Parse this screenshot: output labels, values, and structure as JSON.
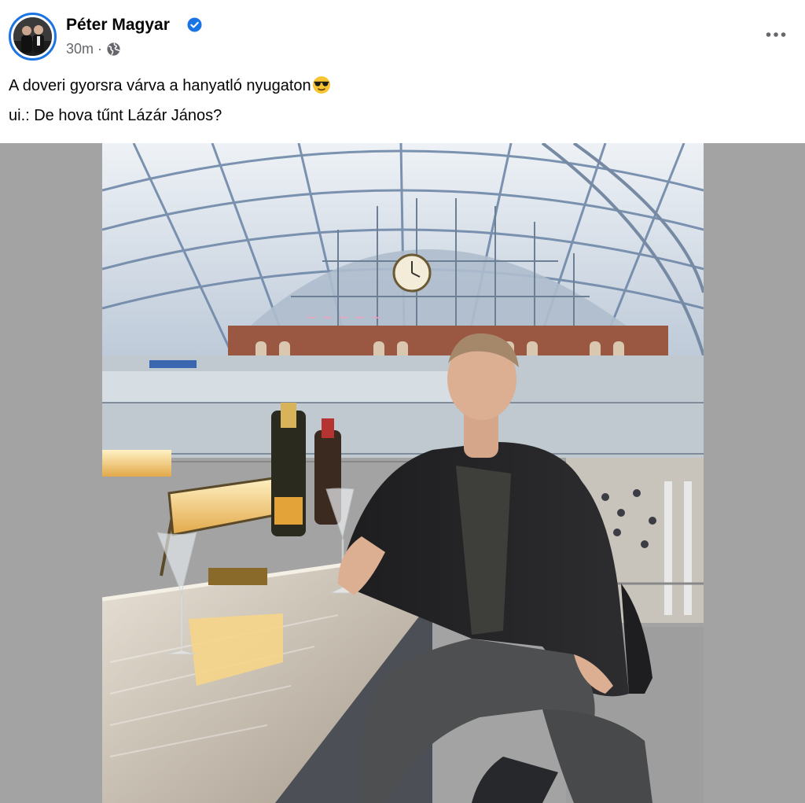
{
  "post": {
    "author_name": "Péter Magyar",
    "verified": true,
    "time": "30m",
    "separator": "·",
    "audience_icon": "globe-icon",
    "text_line1": "A doveri gyorsra várva a hanyatló nyugaton",
    "text_line1_emoji": "smiling-face-with-sunglasses",
    "text_line2": "ui.: De hova tűnt Lázár János?"
  },
  "colors": {
    "verified_blue": "#1b74e4",
    "meta_gray": "#65676b",
    "media_background": "#a3a3a3"
  }
}
